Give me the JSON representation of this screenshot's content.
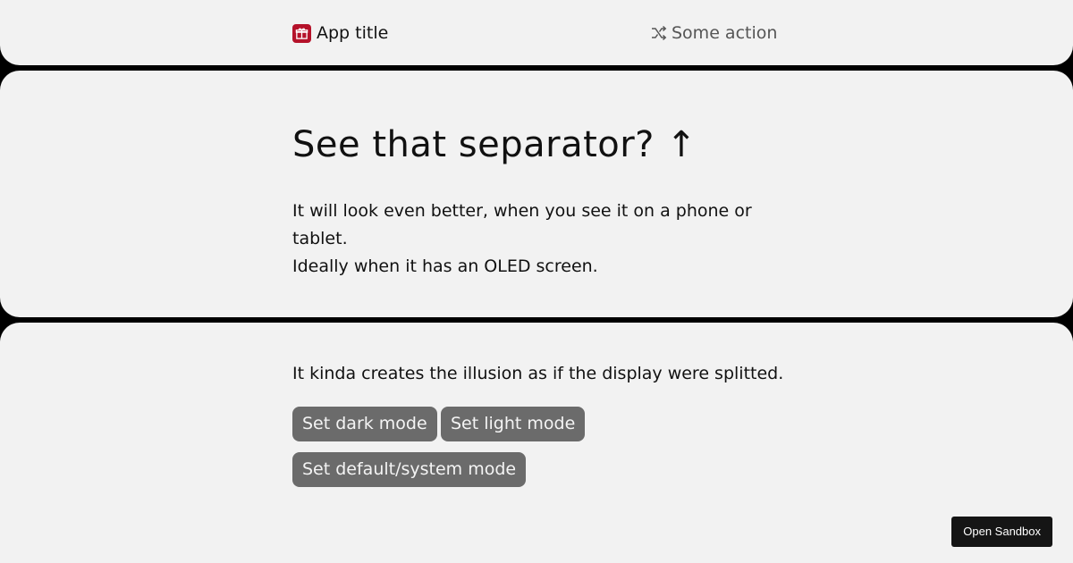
{
  "header": {
    "app_title": "App title",
    "app_icon": "gift-icon",
    "action_label": "Some action",
    "action_icon": "shuffle-icon"
  },
  "hero": {
    "heading": "See that separator? ↑",
    "paragraph_line1": "It will look even better, when you see it on a phone or tablet.",
    "paragraph_line2": "Ideally when it has an OLED screen."
  },
  "bottom": {
    "text": "It kinda creates the illusion as if the display were splitted.",
    "buttons": {
      "dark": "Set dark mode",
      "light": "Set light mode",
      "default": "Set default/system mode"
    }
  },
  "sandbox": {
    "label": "Open Sandbox"
  },
  "colors": {
    "panel_bg": "#f2f2f2",
    "separator": "#000000",
    "brand_red": "#b5122a",
    "button_bg": "#6b6b6b"
  }
}
